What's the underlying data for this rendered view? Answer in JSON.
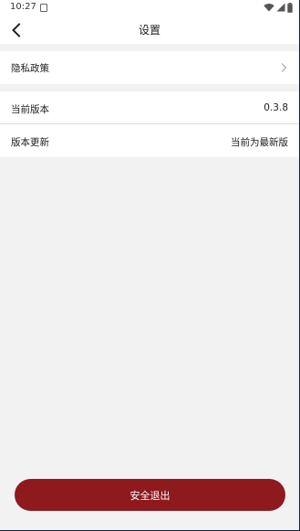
{
  "status_bar": {
    "time": "10:27",
    "icons": [
      "notification-icon",
      "wifi-icon",
      "signal-icon",
      "battery-icon"
    ]
  },
  "header": {
    "back_icon": "chevron-left-icon",
    "title": "设置"
  },
  "settings": {
    "privacy": {
      "label": "隐私政策",
      "icon": "chevron-right-icon"
    },
    "version": {
      "label": "当前版本",
      "value": "0.3.8"
    },
    "update": {
      "label": "版本更新",
      "value": "当前为最新版"
    }
  },
  "logout": {
    "label": "安全退出"
  },
  "colors": {
    "background": "#f2f2f2",
    "card": "#ffffff",
    "logout_button": "#8f1a1e",
    "divider": "#dcdcdc"
  }
}
